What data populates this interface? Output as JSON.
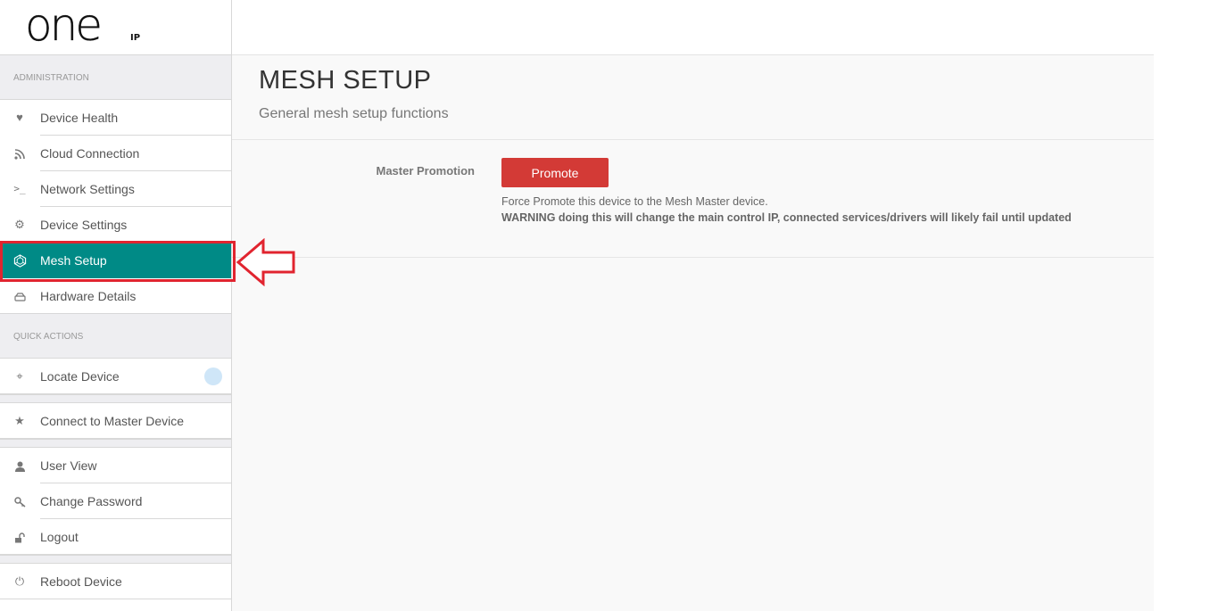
{
  "logo": {
    "main": "one",
    "sub": "IP"
  },
  "sidebar": {
    "admin_header": "ADMINISTRATION",
    "admin_items": [
      {
        "label": "Device Health",
        "icon": "heart-icon"
      },
      {
        "label": "Cloud Connection",
        "icon": "rss-icon"
      },
      {
        "label": "Network Settings",
        "icon": "terminal-icon"
      },
      {
        "label": "Device Settings",
        "icon": "gear-icon"
      },
      {
        "label": "Mesh Setup",
        "icon": "mesh-icon",
        "active": true
      },
      {
        "label": "Hardware Details",
        "icon": "drive-icon"
      }
    ],
    "quick_header": "QUICK ACTIONS",
    "locate_label": "Locate Device",
    "connect_label": "Connect to Master Device",
    "user_items": [
      {
        "label": "User View",
        "icon": "user-icon"
      },
      {
        "label": "Change Password",
        "icon": "key-icon"
      },
      {
        "label": "Logout",
        "icon": "unlock-icon"
      }
    ],
    "reboot_label": "Reboot Device"
  },
  "main": {
    "title": "MESH SETUP",
    "subtitle": "General mesh setup functions",
    "field_label": "Master Promotion",
    "promote_button": "Promote",
    "help_line": "Force Promote this device to the Mesh Master device.",
    "warning_line": "WARNING doing this will change the main control IP, connected services/drivers will likely fail until updated"
  },
  "colors": {
    "active": "#008a86",
    "button": "#d33a36",
    "highlight": "#e1242f"
  }
}
